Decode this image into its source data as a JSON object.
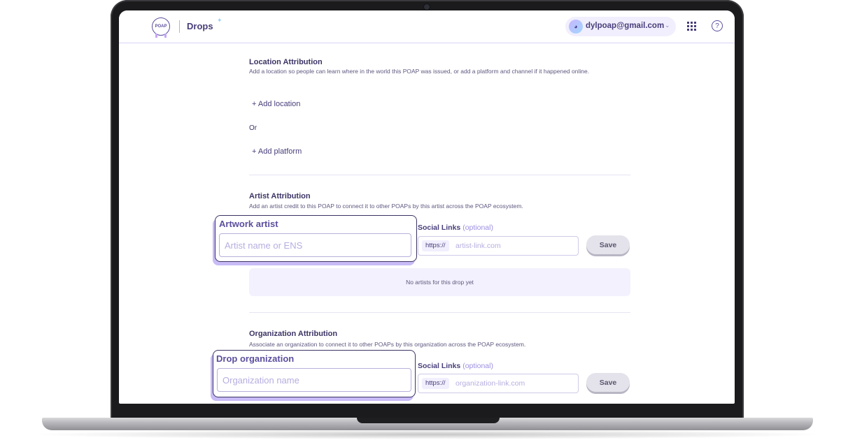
{
  "header": {
    "logo_text": "POAP",
    "title": "Drops",
    "account_email": "dylpoap@gmail.com"
  },
  "location": {
    "title": "Location Attribution",
    "description": "Add a location so people can learn where in the world this POAP was issued, or add a platform and channel if it happened online.",
    "add_location": "+ Add location",
    "or_text": "Or",
    "add_platform": "+ Add platform"
  },
  "artist": {
    "title": "Artist Attribution",
    "description": "Add an artist credit to this POAP to connect it to other POAPs by this artist across the POAP ecosystem.",
    "field_label": "Artwork artist",
    "field_placeholder": "Artist name or ENS",
    "social_label": "Social Links",
    "social_optional": "(optional)",
    "link_prefix": "https://",
    "link_placeholder": "artist-link.com",
    "save_label": "Save",
    "empty_message": "No artists for this drop yet"
  },
  "organization": {
    "title": "Organization Attribution",
    "description": "Associate an organization to connect it to other POAPs by this organization across the POAP ecosystem.",
    "field_label": "Drop organization",
    "field_placeholder": "Organization name",
    "social_label": "Social Links",
    "social_optional": "(optional)",
    "link_prefix": "https://",
    "link_placeholder": "organization-link.com",
    "save_label": "Save"
  },
  "icons": [
    "poap-logo-icon",
    "sparkle-icon",
    "avatar",
    "chevron-down-icon",
    "apps-grid-icon",
    "help-icon"
  ],
  "colors": {
    "accent": "#5b4f9e",
    "text_dark": "#3b3464",
    "callout_shadow": "#c8bbf6",
    "surface_light": "#f3f1fd"
  }
}
